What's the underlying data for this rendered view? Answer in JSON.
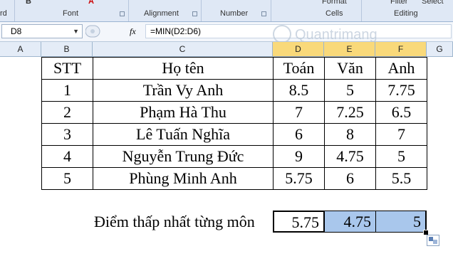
{
  "ribbon": {
    "groups": [
      "Font",
      "Alignment",
      "Number",
      "Cells",
      "Editing"
    ],
    "left_cut": "rd",
    "top_items": [
      "Format",
      "Filter",
      "Select"
    ]
  },
  "formula_bar": {
    "name_box": "D8",
    "fx_label": "fx",
    "formula": "=MIN(D2:D6)"
  },
  "columns": [
    "A",
    "B",
    "C",
    "D",
    "E",
    "F",
    "G"
  ],
  "selected_columns": [
    "D",
    "E",
    "F"
  ],
  "table": {
    "headers": [
      "STT",
      "Họ tên",
      "Toán",
      "Văn",
      "Anh"
    ],
    "rows": [
      [
        "1",
        "Trần Vy Anh",
        "8.5",
        "5",
        "7.75"
      ],
      [
        "2",
        "Phạm Hà Thu",
        "7",
        "7.25",
        "6.5"
      ],
      [
        "3",
        "Lê Tuấn Nghĩa",
        "6",
        "8",
        "7"
      ],
      [
        "4",
        "Nguyễn Trung Đức",
        "9",
        "4.75",
        "5"
      ],
      [
        "5",
        "Phùng Minh Anh",
        "5.75",
        "6",
        "5.5"
      ]
    ]
  },
  "min_row": {
    "label": "Điểm thấp nhất từng môn",
    "values": [
      "5.75",
      "4.75",
      "5"
    ]
  },
  "watermark": "Quantrimang"
}
